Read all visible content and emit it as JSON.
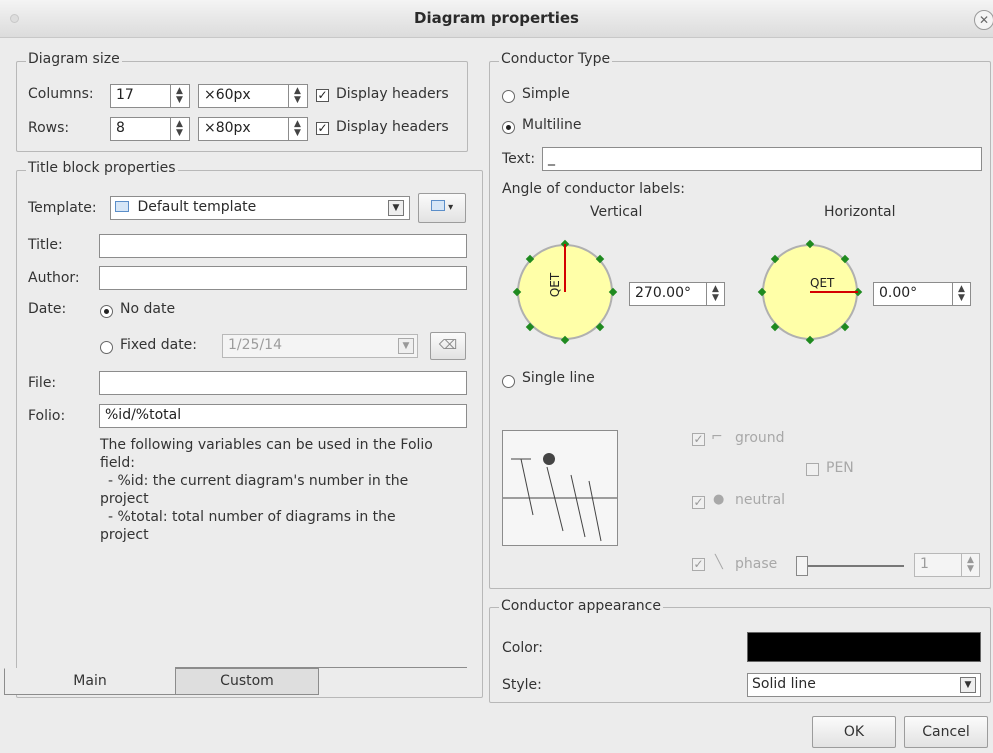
{
  "window": {
    "title": "Diagram properties",
    "close_glyph": "✕"
  },
  "diagram_size": {
    "legend": "Diagram size",
    "columns_label": "Columns:",
    "columns_value": "17",
    "columns_width": "×60px",
    "rows_label": "Rows:",
    "rows_value": "8",
    "rows_height": "×80px",
    "display_headers_label": "Display headers",
    "columns_display_headers": true,
    "rows_display_headers": true
  },
  "title_block": {
    "legend": "Title block properties",
    "template_label": "Template:",
    "template_value": "Default template",
    "title_label": "Title:",
    "title_value": "",
    "author_label": "Author:",
    "author_value": "",
    "date_label": "Date:",
    "no_date_label": "No date",
    "fixed_date_label": "Fixed date:",
    "fixed_date_value": "1/25/14",
    "file_label": "File:",
    "file_value": "",
    "folio_label": "Folio:",
    "folio_value": "%id/%total",
    "help_lines": [
      "The following variables can be used in the Folio",
      "field:",
      "  - %id: the current diagram's number in the",
      "project",
      "  - %total: total number of diagrams in the",
      "project"
    ],
    "tabs": [
      "Main",
      "Custom"
    ]
  },
  "conductor_type": {
    "legend": "Conductor Type",
    "simple_label": "Simple",
    "multiline_label": "Multiline",
    "selected": "Multiline",
    "text_label": "Text:",
    "text_value": "_",
    "angle_label": "Angle of conductor labels:",
    "vertical_label": "Vertical",
    "horizontal_label": "Horizontal",
    "dial_text": "QET",
    "vertical_angle": "270.00°",
    "horizontal_angle": "0.00°",
    "single_line_label": "Single line",
    "ground_label": "ground",
    "pen_label": "PEN",
    "neutral_label": "neutral",
    "phase_label": "phase",
    "phase_value": "1",
    "ground_checked": true,
    "pen_checked": false,
    "neutral_checked": true,
    "phase_checked": true,
    "phase_slider_level": 0
  },
  "appearance": {
    "legend": "Conductor appearance",
    "color_label": "Color:",
    "color_value": "#000000",
    "style_label": "Style:",
    "style_value": "Solid line"
  },
  "buttons": {
    "ok": "OK",
    "cancel": "Cancel"
  },
  "colors": {
    "accent_dial": "#ffffa8",
    "dial_handle": "#1f8a1f",
    "needle": "#d40000"
  }
}
